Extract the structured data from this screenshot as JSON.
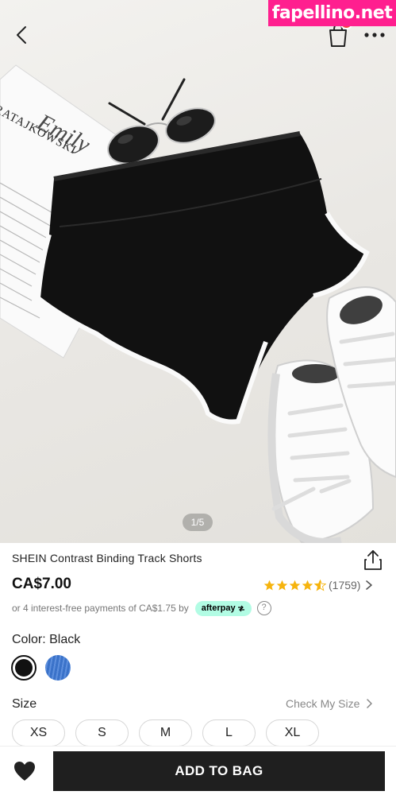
{
  "watermark": {
    "text": "fapellino.net",
    "color": "#ff1f8f"
  },
  "header": {
    "back_icon": "chevron-left-icon",
    "bag_icon": "shopping-bag-icon",
    "more_icon": "ellipsis-icon"
  },
  "gallery": {
    "pager": "1/5",
    "magazine_lines": [
      "Emily",
      "RATAJKOWSKI"
    ]
  },
  "product": {
    "title": "SHEIN Contrast Binding Track Shorts",
    "price": "CA$7.00",
    "rating_stars": 4.5,
    "rating_count": "(1759)",
    "afterpay_text": "or 4 interest-free payments of CA$1.75 by",
    "afterpay_badge": "afterpay",
    "help": "?",
    "share_icon": "share-icon"
  },
  "color": {
    "label": "Color: Black",
    "options": [
      {
        "name": "black",
        "hex": "#111111",
        "selected": true
      },
      {
        "name": "blue",
        "hex": "#3a72c9",
        "selected": false
      }
    ]
  },
  "size": {
    "label": "Size",
    "guide": "Check My Size",
    "options": [
      "XS",
      "S",
      "M",
      "L",
      "XL"
    ]
  },
  "cta": {
    "add_to_bag": "ADD TO BAG",
    "wishlist_icon": "heart-icon"
  },
  "colors": {
    "star": "#f6b40e",
    "primary": "#1f1f1f",
    "badge": "#f2453d",
    "afterpay": "#b2fce4"
  }
}
